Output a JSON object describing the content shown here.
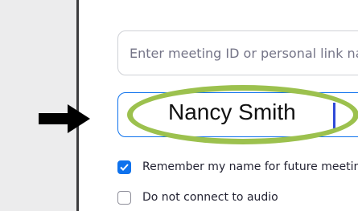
{
  "join_form": {
    "meeting_id": {
      "placeholder": "Enter meeting ID or personal link name",
      "value": ""
    },
    "name": {
      "value": "Nancy Smith"
    },
    "options": [
      {
        "label": "Remember my name for future meetings",
        "checked": true
      },
      {
        "label": "Do not connect to audio",
        "checked": false
      }
    ]
  },
  "annotations": {
    "arrow_icon": "right-arrow-icon",
    "highlight_color": "#9cc14e"
  },
  "colors": {
    "accent": "#0e72ed",
    "caret": "#2f4ad8"
  }
}
